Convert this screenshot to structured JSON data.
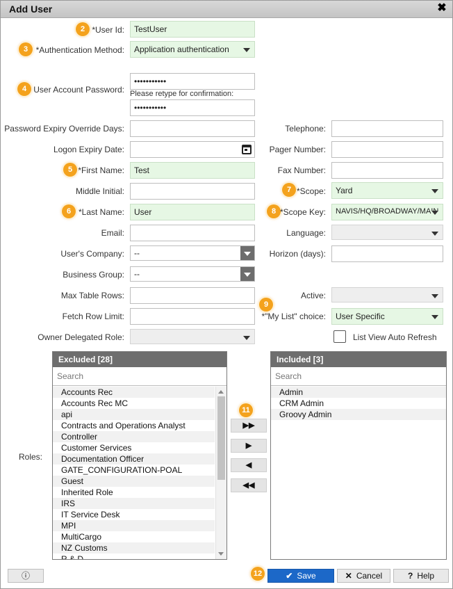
{
  "title": "Add User",
  "icons": {
    "close": "close-icon",
    "calendar": "calendar-icon",
    "info": "info-icon",
    "save": "checkmark-icon",
    "cancel": "x-icon",
    "help": "help-icon"
  },
  "colors": {
    "required_field_bg": "#e6f7e4",
    "badge": "#f4a21d",
    "save_button": "#1c68c8",
    "panel_header": "#6e6e6e"
  },
  "badges": [
    "2",
    "3",
    "4",
    "5",
    "6",
    "7",
    "8",
    "9",
    "11",
    "12"
  ],
  "form": {
    "user_id": {
      "label": "*User Id:",
      "value": "TestUser"
    },
    "auth_method": {
      "label": "*Authentication Method:",
      "value": "Application authentication"
    },
    "password": {
      "label": "User Account Password:",
      "value": "•••••••••••",
      "confirm_label": "Please retype for confirmation:",
      "confirm_value": "•••••••••••"
    },
    "pw_expiry_override": {
      "label": "Password Expiry Override Days:",
      "value": ""
    },
    "logon_expiry": {
      "label": "Logon Expiry Date:",
      "value": ""
    },
    "first_name": {
      "label": "*First Name:",
      "value": "Test"
    },
    "middle_initial": {
      "label": "Middle Initial:",
      "value": ""
    },
    "last_name": {
      "label": "*Last Name:",
      "value": "User"
    },
    "email": {
      "label": "Email:",
      "value": ""
    },
    "company": {
      "label": "User's Company:",
      "value": "--"
    },
    "business_group": {
      "label": "Business Group:",
      "value": "--"
    },
    "max_table_rows": {
      "label": "Max Table Rows:",
      "value": ""
    },
    "fetch_row_limit": {
      "label": "Fetch Row Limit:",
      "value": ""
    },
    "owner_delegated_role": {
      "label": "Owner Delegated Role:",
      "value": ""
    },
    "telephone": {
      "label": "Telephone:",
      "value": ""
    },
    "pager_number": {
      "label": "Pager Number:",
      "value": ""
    },
    "fax_number": {
      "label": "Fax Number:",
      "value": ""
    },
    "scope": {
      "label": "*Scope:",
      "value": "Yard"
    },
    "scope_key": {
      "label": "*Scope Key:",
      "value": "NAVIS/HQ/BROADWAY/MAIN"
    },
    "language": {
      "label": "Language:",
      "value": ""
    },
    "horizon_days": {
      "label": "Horizon (days):",
      "value": ""
    },
    "active": {
      "label": "Active:",
      "value": ""
    },
    "my_list_choice": {
      "label": "*\"My List\" choice:",
      "value": "User Specific"
    },
    "list_view_auto_refresh": {
      "label": "List View Auto Refresh",
      "checked": false
    }
  },
  "roles": {
    "label": "Roles:",
    "excluded_header": "Excluded [28]",
    "included_header": "Included [3]",
    "search_placeholder": "Search",
    "excluded": [
      "Accounts Rec",
      "Accounts Rec MC",
      "api",
      "Contracts and Operations Analyst",
      "Controller",
      "Customer Services",
      "Documentation Officer",
      "GATE_CONFIGURATION-POAL",
      "Guest",
      "Inherited Role",
      "IRS",
      "IT Service Desk",
      "MPI",
      "MultiCargo",
      "NZ Customs",
      "R & D"
    ],
    "included": [
      "Admin",
      "CRM Admin",
      "Groovy Admin"
    ],
    "move_buttons": [
      "▶▶",
      "▶",
      "◀",
      "◀◀"
    ]
  },
  "footer": {
    "info_label": "ⓘ",
    "save_label": "Save",
    "cancel_label": "Cancel",
    "help_label": "Help"
  }
}
